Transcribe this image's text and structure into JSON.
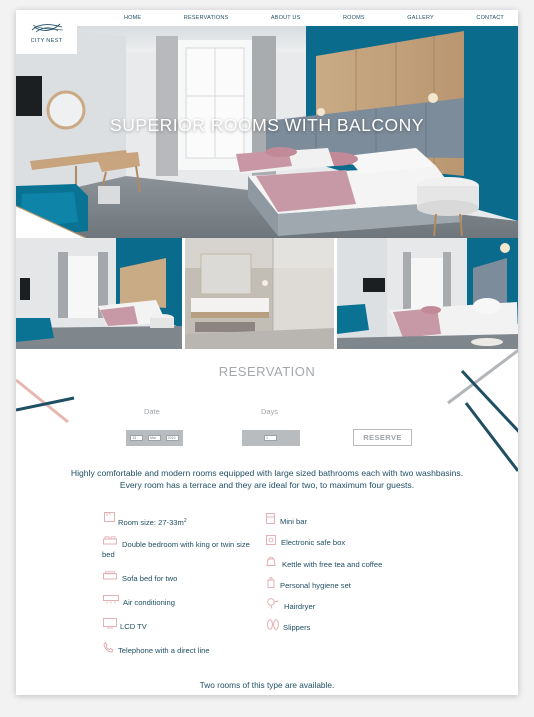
{
  "brand": {
    "name": "CITY NEST"
  },
  "nav": [
    "HOME",
    "RESERVATIONS",
    "ABOUT US",
    "ROOMS",
    "GALLERY",
    "CONTACT"
  ],
  "hero": {
    "title": "SUPERIOR ROOMS WITH BALCONY"
  },
  "reservation": {
    "title": "RESERVATION",
    "date_label": "Date",
    "days_label": "Days",
    "date_day": "23",
    "date_month": "Mar",
    "date_year": "2019",
    "days_value": "1",
    "reserve_label": "RESERVE"
  },
  "intro": {
    "line1": "Highly comfortable and modern rooms equipped with large sized bathrooms each with two washbasins.",
    "line2": "Every room has a terrace and they are ideal for two, to maximum four guests."
  },
  "amenities_left": [
    {
      "label": "Room size: 27-33m",
      "icon": "ruler-icon",
      "sup": "2"
    },
    {
      "label": "Double bedroom with king or twin size bed",
      "icon": "double-bed-icon"
    },
    {
      "label": "Sofa bed for two",
      "icon": "sofa-bed-icon"
    },
    {
      "label": "Air conditioning",
      "icon": "air-conditioning-icon"
    },
    {
      "label": "LCD TV",
      "icon": "tv-icon"
    },
    {
      "label": "Telephone with a direct line",
      "icon": "telephone-icon"
    }
  ],
  "amenities_right": [
    {
      "label": "Mini bar",
      "icon": "minibar-icon"
    },
    {
      "label": "Electronic safe box",
      "icon": "safe-icon"
    },
    {
      "label": "Kettle with free tea and coffee",
      "icon": "kettle-icon"
    },
    {
      "label": "Personal hygiene set",
      "icon": "hygiene-icon"
    },
    {
      "label": "Hairdryer",
      "icon": "hairdryer-icon"
    },
    {
      "label": "Slippers",
      "icon": "slippers-icon"
    }
  ],
  "availability": "Two rooms of this type are available.",
  "colors": {
    "accent": "#1f4f63",
    "muted": "#a3a8ac",
    "teal_wall": "#0b6b8c",
    "pink": "#b98595"
  }
}
